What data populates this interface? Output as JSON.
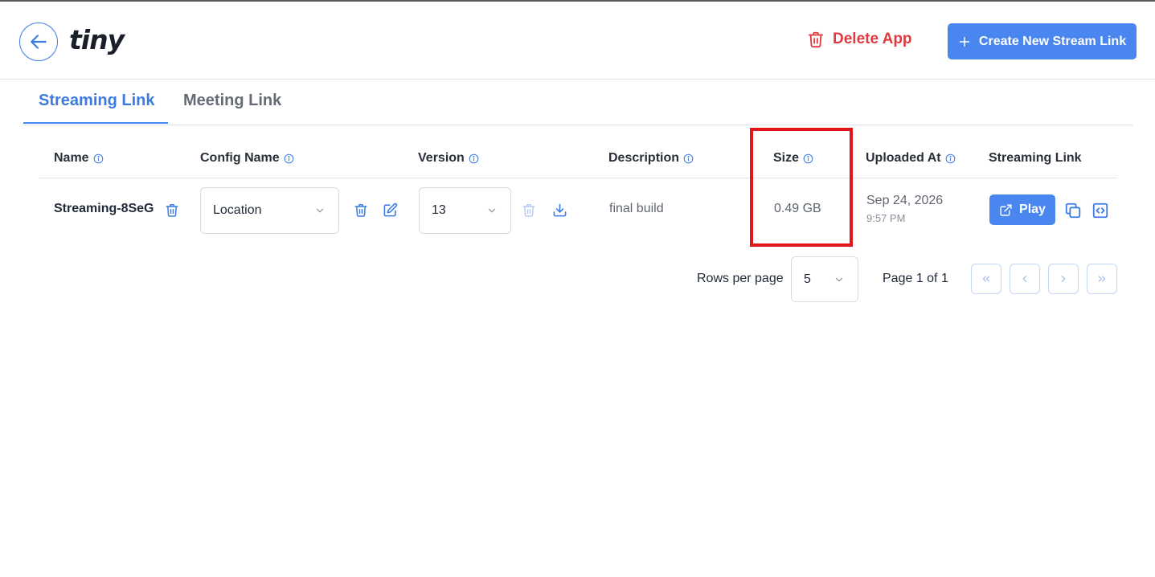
{
  "header": {
    "logo": "tiny",
    "delete_label": "Delete App",
    "create_label": "Create New Stream Link"
  },
  "tabs": [
    {
      "label": "Streaming Link",
      "active": true
    },
    {
      "label": "Meeting Link",
      "active": false
    }
  ],
  "table": {
    "columns": [
      "Name",
      "Config Name",
      "Version",
      "Description",
      "Size",
      "Uploaded At",
      "Streaming Link"
    ],
    "rows": [
      {
        "name": "Streaming-8SeG",
        "config_name": "Location",
        "version": "13",
        "description": "final build",
        "size": "0.49 GB",
        "uploaded_date": "Sep 24, 2026",
        "uploaded_time": "9:57 PM",
        "play_label": "Play"
      }
    ]
  },
  "pagination": {
    "rows_per_page_label": "Rows per page",
    "rows_per_page": "5",
    "page_label": "Page 1 of 1"
  },
  "colors": {
    "accent": "#4a86f0",
    "danger": "#e0393e",
    "highlight": "#e0161b"
  }
}
